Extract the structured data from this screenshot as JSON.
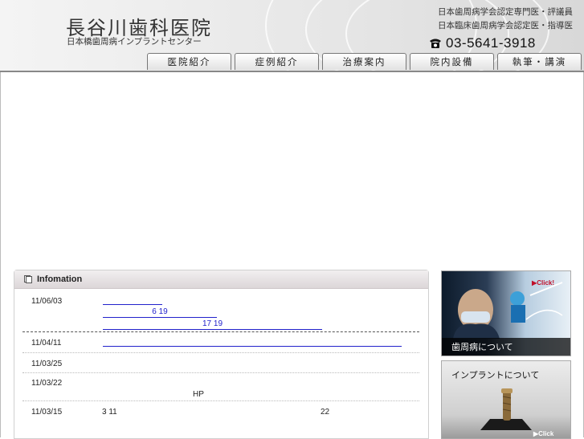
{
  "header": {
    "title": "長谷川歯科医院",
    "subtitle": "日本橋歯周病インプラントセンター",
    "cert1": "日本歯周病学会認定専門医・評議員",
    "cert2": "日本臨床歯周病学会認定医・指導医",
    "phone": "03-5641-3918",
    "phone_icon": "phone-icon"
  },
  "nav": {
    "items": [
      {
        "label": "医院紹介"
      },
      {
        "label": "症例紹介"
      },
      {
        "label": "治療案内"
      },
      {
        "label": "院内設備"
      },
      {
        "label": "執筆・講演"
      }
    ]
  },
  "info": {
    "title": "Infomation",
    "rows": [
      {
        "date": "11/06/03",
        "lines": [
          "",
          "6 19",
          "17 19"
        ]
      },
      {
        "date": "11/04/11",
        "lines": [
          ""
        ]
      },
      {
        "date": "11/03/25",
        "lines": []
      },
      {
        "date": "11/03/22",
        "lines": [
          "HP"
        ]
      },
      {
        "date": "11/03/15",
        "lines": [
          "3 11",
          "22"
        ]
      }
    ]
  },
  "banners": {
    "perio_label": "歯周病について",
    "implant_label": "インプラントについて",
    "click1": "▶Click!",
    "click2": "▶Click"
  },
  "colors": {
    "link": "#2222cc",
    "header_bg": "#e4e4e4"
  }
}
